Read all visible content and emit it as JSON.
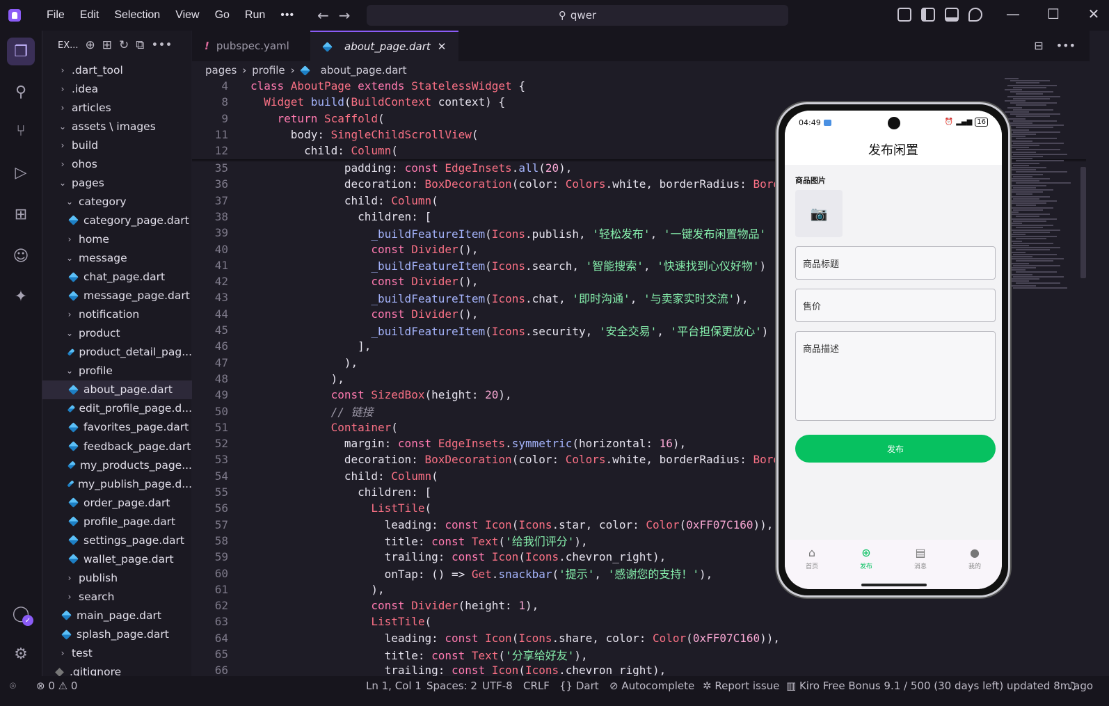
{
  "menu": [
    "File",
    "Edit",
    "Selection",
    "View",
    "Go",
    "Run"
  ],
  "menu_more": "•••",
  "search": {
    "text": "qwer"
  },
  "nav": {
    "back": "←",
    "forward": "→"
  },
  "sidebar": {
    "header": "EX...",
    "items": [
      {
        "label": ".dart_tool",
        "type": "folder",
        "open": false,
        "depth": 0
      },
      {
        "label": ".idea",
        "type": "folder",
        "open": false,
        "depth": 0
      },
      {
        "label": "articles",
        "type": "folder",
        "open": false,
        "depth": 0
      },
      {
        "label": "assets \\ images",
        "type": "folder",
        "open": true,
        "depth": 0
      },
      {
        "label": "build",
        "type": "folder",
        "open": false,
        "depth": 0
      },
      {
        "label": "ohos",
        "type": "folder",
        "open": false,
        "depth": 0
      },
      {
        "label": "pages",
        "type": "folder",
        "open": true,
        "depth": 0
      },
      {
        "label": "category",
        "type": "folder",
        "open": true,
        "depth": 1
      },
      {
        "label": "category_page.dart",
        "type": "dart",
        "depth": 2
      },
      {
        "label": "home",
        "type": "folder",
        "open": false,
        "depth": 1
      },
      {
        "label": "message",
        "type": "folder",
        "open": true,
        "depth": 1
      },
      {
        "label": "chat_page.dart",
        "type": "dart",
        "depth": 2
      },
      {
        "label": "message_page.dart",
        "type": "dart",
        "depth": 2
      },
      {
        "label": "notification",
        "type": "folder",
        "open": false,
        "depth": 1
      },
      {
        "label": "product",
        "type": "folder",
        "open": true,
        "depth": 1
      },
      {
        "label": "product_detail_pag...",
        "type": "dart",
        "depth": 2
      },
      {
        "label": "profile",
        "type": "folder",
        "open": true,
        "depth": 1
      },
      {
        "label": "about_page.dart",
        "type": "dart",
        "depth": 2,
        "selected": true
      },
      {
        "label": "edit_profile_page.d...",
        "type": "dart",
        "depth": 2
      },
      {
        "label": "favorites_page.dart",
        "type": "dart",
        "depth": 2
      },
      {
        "label": "feedback_page.dart",
        "type": "dart",
        "depth": 2
      },
      {
        "label": "my_products_page...",
        "type": "dart",
        "depth": 2
      },
      {
        "label": "my_publish_page.d...",
        "type": "dart",
        "depth": 2
      },
      {
        "label": "order_page.dart",
        "type": "dart",
        "depth": 2
      },
      {
        "label": "profile_page.dart",
        "type": "dart",
        "depth": 2
      },
      {
        "label": "settings_page.dart",
        "type": "dart",
        "depth": 2
      },
      {
        "label": "wallet_page.dart",
        "type": "dart",
        "depth": 2
      },
      {
        "label": "publish",
        "type": "folder",
        "open": false,
        "depth": 1
      },
      {
        "label": "search",
        "type": "folder",
        "open": false,
        "depth": 1
      },
      {
        "label": "main_page.dart",
        "type": "dart",
        "depth": 1
      },
      {
        "label": "splash_page.dart",
        "type": "dart",
        "depth": 1
      },
      {
        "label": "test",
        "type": "folder",
        "open": false,
        "depth": 0
      },
      {
        "label": ".gitignore",
        "type": "git",
        "depth": 0
      }
    ]
  },
  "tabs": [
    {
      "label": "pubspec.yaml",
      "prefix": "!",
      "active": false
    },
    {
      "label": "about_page.dart",
      "active": true,
      "close": "✕"
    }
  ],
  "tab_actions": [
    "⊟",
    "•••"
  ],
  "breadcrumb": [
    "pages",
    "profile",
    "about_page.dart"
  ],
  "code": [
    {
      "n": "4",
      "tokens": [
        [
          "k",
          "class "
        ],
        [
          "cls",
          "AboutPage "
        ],
        [
          "k",
          "extends "
        ],
        [
          "cls",
          "StatelessWidget "
        ],
        [
          "p",
          "{"
        ]
      ]
    },
    {
      "n": "8",
      "tokens": [
        [
          "p",
          "  "
        ],
        [
          "cls",
          "Widget "
        ],
        [
          "f",
          "build"
        ],
        [
          "p",
          "("
        ],
        [
          "cls",
          "BuildContext "
        ],
        [
          "p",
          "context) {"
        ]
      ]
    },
    {
      "n": "9",
      "tokens": [
        [
          "p",
          "    "
        ],
        [
          "k",
          "return "
        ],
        [
          "cls",
          "Scaffold"
        ],
        [
          "p",
          "("
        ]
      ]
    },
    {
      "n": "11",
      "tokens": [
        [
          "p",
          "      body: "
        ],
        [
          "cls",
          "SingleChildScrollView"
        ],
        [
          "p",
          "("
        ]
      ]
    },
    {
      "n": "12",
      "tokens": [
        [
          "p",
          "        child: "
        ],
        [
          "cls",
          "Column"
        ],
        [
          "p",
          "("
        ]
      ]
    },
    {
      "n": "35",
      "tokens": [
        [
          "p",
          "              padding: "
        ],
        [
          "k",
          "const "
        ],
        [
          "cls",
          "EdgeInsets"
        ],
        [
          "p",
          "."
        ],
        [
          "f",
          "all"
        ],
        [
          "p",
          "("
        ],
        [
          "n",
          "20"
        ],
        [
          "p",
          "),"
        ]
      ]
    },
    {
      "n": "36",
      "tokens": [
        [
          "p",
          "              decoration: "
        ],
        [
          "cls",
          "BoxDecoration"
        ],
        [
          "p",
          "(color: "
        ],
        [
          "cls",
          "Colors"
        ],
        [
          "p",
          ".white, borderRadius: "
        ],
        [
          "cls",
          "Bord"
        ]
      ]
    },
    {
      "n": "37",
      "tokens": [
        [
          "p",
          "              child: "
        ],
        [
          "cls",
          "Column"
        ],
        [
          "p",
          "("
        ]
      ]
    },
    {
      "n": "38",
      "tokens": [
        [
          "p",
          "                children: ["
        ]
      ]
    },
    {
      "n": "39",
      "tokens": [
        [
          "p",
          "                  "
        ],
        [
          "f",
          "_buildFeatureItem"
        ],
        [
          "p",
          "("
        ],
        [
          "cls",
          "Icons"
        ],
        [
          "p",
          ".publish, "
        ],
        [
          "s",
          "'轻松发布'"
        ],
        [
          "p",
          ", "
        ],
        [
          "s",
          "'一键发布闲置物品'"
        ]
      ]
    },
    {
      "n": "40",
      "tokens": [
        [
          "p",
          "                  "
        ],
        [
          "k",
          "const "
        ],
        [
          "cls",
          "Divider"
        ],
        [
          "p",
          "(),"
        ]
      ]
    },
    {
      "n": "41",
      "tokens": [
        [
          "p",
          "                  "
        ],
        [
          "f",
          "_buildFeatureItem"
        ],
        [
          "p",
          "("
        ],
        [
          "cls",
          "Icons"
        ],
        [
          "p",
          ".search, "
        ],
        [
          "s",
          "'智能搜索'"
        ],
        [
          "p",
          ", "
        ],
        [
          "s",
          "'快速找到心仪好物'"
        ],
        [
          "p",
          ")"
        ]
      ]
    },
    {
      "n": "42",
      "tokens": [
        [
          "p",
          "                  "
        ],
        [
          "k",
          "const "
        ],
        [
          "cls",
          "Divider"
        ],
        [
          "p",
          "(),"
        ]
      ]
    },
    {
      "n": "43",
      "tokens": [
        [
          "p",
          "                  "
        ],
        [
          "f",
          "_buildFeatureItem"
        ],
        [
          "p",
          "("
        ],
        [
          "cls",
          "Icons"
        ],
        [
          "p",
          ".chat, "
        ],
        [
          "s",
          "'即时沟通'"
        ],
        [
          "p",
          ", "
        ],
        [
          "s",
          "'与卖家实时交流'"
        ],
        [
          "p",
          "),"
        ]
      ]
    },
    {
      "n": "44",
      "tokens": [
        [
          "p",
          "                  "
        ],
        [
          "k",
          "const "
        ],
        [
          "cls",
          "Divider"
        ],
        [
          "p",
          "(),"
        ]
      ]
    },
    {
      "n": "45",
      "tokens": [
        [
          "p",
          "                  "
        ],
        [
          "f",
          "_buildFeatureItem"
        ],
        [
          "p",
          "("
        ],
        [
          "cls",
          "Icons"
        ],
        [
          "p",
          ".security, "
        ],
        [
          "s",
          "'安全交易'"
        ],
        [
          "p",
          ", "
        ],
        [
          "s",
          "'平台担保更放心'"
        ],
        [
          "p",
          ")"
        ]
      ]
    },
    {
      "n": "46",
      "tokens": [
        [
          "p",
          "                ],"
        ]
      ]
    },
    {
      "n": "47",
      "tokens": [
        [
          "p",
          "              ),"
        ]
      ]
    },
    {
      "n": "48",
      "tokens": [
        [
          "p",
          "            ),"
        ]
      ]
    },
    {
      "n": "49",
      "tokens": [
        [
          "p",
          "            "
        ],
        [
          "k",
          "const "
        ],
        [
          "cls",
          "SizedBox"
        ],
        [
          "p",
          "(height: "
        ],
        [
          "n",
          "20"
        ],
        [
          "p",
          "),"
        ]
      ]
    },
    {
      "n": "50",
      "tokens": [
        [
          "c",
          "            // 链接"
        ]
      ]
    },
    {
      "n": "51",
      "tokens": [
        [
          "p",
          "            "
        ],
        [
          "cls",
          "Container"
        ],
        [
          "p",
          "("
        ]
      ]
    },
    {
      "n": "52",
      "tokens": [
        [
          "p",
          "              margin: "
        ],
        [
          "k",
          "const "
        ],
        [
          "cls",
          "EdgeInsets"
        ],
        [
          "p",
          "."
        ],
        [
          "f",
          "symmetric"
        ],
        [
          "p",
          "(horizontal: "
        ],
        [
          "n",
          "16"
        ],
        [
          "p",
          "),"
        ]
      ]
    },
    {
      "n": "53",
      "tokens": [
        [
          "p",
          "              decoration: "
        ],
        [
          "cls",
          "BoxDecoration"
        ],
        [
          "p",
          "(color: "
        ],
        [
          "cls",
          "Colors"
        ],
        [
          "p",
          ".white, borderRadius: "
        ],
        [
          "cls",
          "Bord"
        ]
      ]
    },
    {
      "n": "54",
      "tokens": [
        [
          "p",
          "              child: "
        ],
        [
          "cls",
          "Column"
        ],
        [
          "p",
          "("
        ]
      ]
    },
    {
      "n": "55",
      "tokens": [
        [
          "p",
          "                children: ["
        ]
      ]
    },
    {
      "n": "56",
      "tokens": [
        [
          "p",
          "                  "
        ],
        [
          "cls",
          "ListTile"
        ],
        [
          "p",
          "("
        ]
      ]
    },
    {
      "n": "57",
      "tokens": [
        [
          "p",
          "                    leading: "
        ],
        [
          "k",
          "const "
        ],
        [
          "cls",
          "Icon"
        ],
        [
          "p",
          "("
        ],
        [
          "cls",
          "Icons"
        ],
        [
          "p",
          ".star, color: "
        ],
        [
          "cls",
          "Color"
        ],
        [
          "p",
          "("
        ],
        [
          "n",
          "0xFF07C160"
        ],
        [
          "p",
          ")),"
        ]
      ]
    },
    {
      "n": "58",
      "tokens": [
        [
          "p",
          "                    title: "
        ],
        [
          "k",
          "const "
        ],
        [
          "cls",
          "Text"
        ],
        [
          "p",
          "("
        ],
        [
          "s",
          "'给我们评分'"
        ],
        [
          "p",
          "),"
        ]
      ]
    },
    {
      "n": "59",
      "tokens": [
        [
          "p",
          "                    trailing: "
        ],
        [
          "k",
          "const "
        ],
        [
          "cls",
          "Icon"
        ],
        [
          "p",
          "("
        ],
        [
          "cls",
          "Icons"
        ],
        [
          "p",
          ".chevron_right),"
        ]
      ]
    },
    {
      "n": "60",
      "tokens": [
        [
          "p",
          "                    onTap: () => "
        ],
        [
          "cls",
          "Get"
        ],
        [
          "p",
          "."
        ],
        [
          "f",
          "snackbar"
        ],
        [
          "p",
          "("
        ],
        [
          "s",
          "'提示'"
        ],
        [
          "p",
          ", "
        ],
        [
          "s",
          "'感谢您的支持！'"
        ],
        [
          "p",
          "),"
        ]
      ]
    },
    {
      "n": "61",
      "tokens": [
        [
          "p",
          "                  ),"
        ]
      ]
    },
    {
      "n": "62",
      "tokens": [
        [
          "p",
          "                  "
        ],
        [
          "k",
          "const "
        ],
        [
          "cls",
          "Divider"
        ],
        [
          "p",
          "(height: "
        ],
        [
          "n",
          "1"
        ],
        [
          "p",
          "),"
        ]
      ]
    },
    {
      "n": "63",
      "tokens": [
        [
          "p",
          "                  "
        ],
        [
          "cls",
          "ListTile"
        ],
        [
          "p",
          "("
        ]
      ]
    },
    {
      "n": "64",
      "tokens": [
        [
          "p",
          "                    leading: "
        ],
        [
          "k",
          "const "
        ],
        [
          "cls",
          "Icon"
        ],
        [
          "p",
          "("
        ],
        [
          "cls",
          "Icons"
        ],
        [
          "p",
          ".share, color: "
        ],
        [
          "cls",
          "Color"
        ],
        [
          "p",
          "("
        ],
        [
          "n",
          "0xFF07C160"
        ],
        [
          "p",
          ")),"
        ]
      ]
    },
    {
      "n": "65",
      "tokens": [
        [
          "p",
          "                    title: "
        ],
        [
          "k",
          "const "
        ],
        [
          "cls",
          "Text"
        ],
        [
          "p",
          "("
        ],
        [
          "s",
          "'分享给好友'"
        ],
        [
          "p",
          "),"
        ]
      ]
    },
    {
      "n": "66",
      "tokens": [
        [
          "p",
          "                    trailing: "
        ],
        [
          "k",
          "const "
        ],
        [
          "cls",
          "Icon"
        ],
        [
          "p",
          "("
        ],
        [
          "cls",
          "Icons"
        ],
        [
          "p",
          ".chevron_right),"
        ]
      ]
    }
  ],
  "phone": {
    "time": "04:49",
    "battery": "16",
    "title": "发布闲置",
    "image_label": "商品图片",
    "title_placeholder": "商品标题",
    "price_placeholder": "售价",
    "desc_placeholder": "商品描述",
    "publish_button": "发布",
    "nav": [
      {
        "label": "首页",
        "icon": "home-icon",
        "active": false
      },
      {
        "label": "发布",
        "icon": "add-circle-icon",
        "active": true
      },
      {
        "label": "消息",
        "icon": "message-icon",
        "active": false
      },
      {
        "label": "我的",
        "icon": "person-icon",
        "active": false
      }
    ]
  },
  "statusbar": {
    "errors": "0",
    "warnings": "0",
    "position": "Ln 1, Col 1",
    "spaces": "Spaces: 2",
    "encoding": "UTF-8",
    "eol": "CRLF",
    "language": "Dart",
    "autocomplete": "Autocomplete",
    "report": "Report issue",
    "bonus": "Kiro Free Bonus 9.1 / 500 (30 days left) updated 8m ago"
  },
  "colors": {
    "accent": "#8b5cf6",
    "publish_green": "#07c160"
  }
}
